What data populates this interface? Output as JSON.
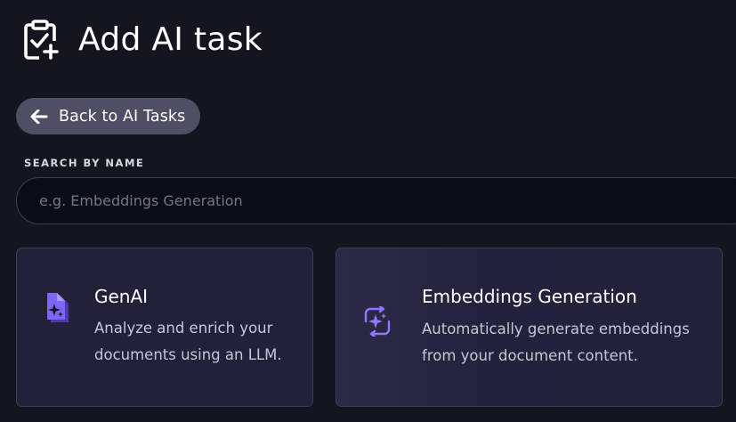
{
  "header": {
    "title": "Add AI task",
    "icon": "clipboard-check-plus-icon"
  },
  "back_button": {
    "label": "Back to AI Tasks",
    "icon": "arrow-left-icon"
  },
  "search": {
    "label": "SEARCH BY NAME",
    "placeholder": "e.g. Embeddings Generation",
    "value": ""
  },
  "cards": [
    {
      "title": "GenAI",
      "description": "Analyze and enrich your documents using an LLM.",
      "icon": "document-sparkle-icon"
    },
    {
      "title": "Embeddings Generation",
      "description": "Automatically generate embeddings from your document  content.",
      "icon": "sparkle-refresh-icon"
    }
  ],
  "colors": {
    "background": "#15151f",
    "button": "#4f4f64",
    "card": "#22213a",
    "accent": "#7b67f7"
  }
}
